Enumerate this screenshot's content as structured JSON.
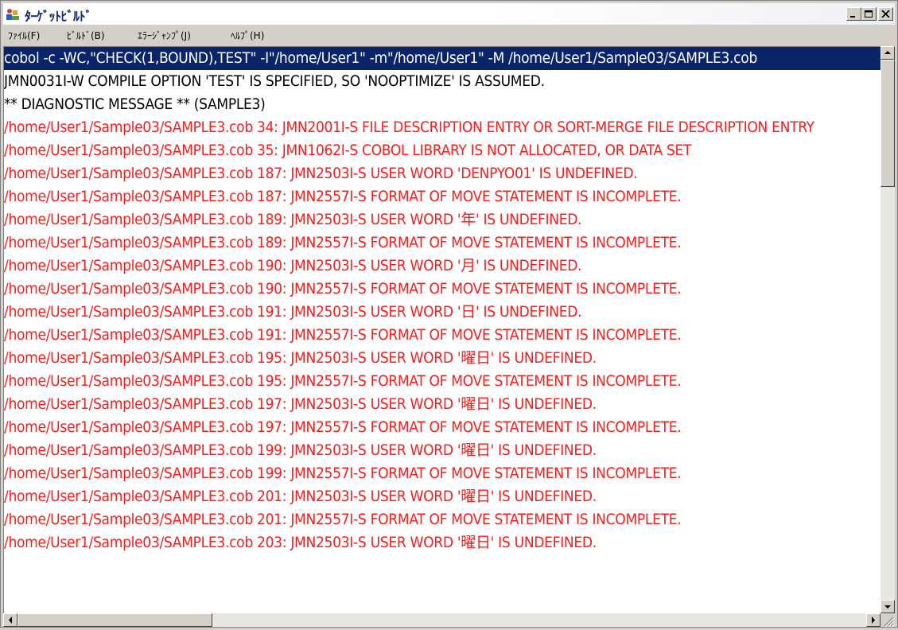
{
  "window": {
    "title": "ﾀｰｹﾞｯﾄﾋﾞﾙﾄﾞ",
    "icon": "build-app-icon",
    "caption_buttons": [
      "minimize-icon",
      "maximize-icon",
      "close-icon"
    ]
  },
  "menu": {
    "items": [
      "ﾌｧｲﾙ(F)",
      "ﾋﾞﾙﾄﾞ(B)",
      "ｴﾗｰｼﾞｬﾝﾌﾟ(J)",
      "ﾍﾙﾌﾟ(H)"
    ]
  },
  "output": {
    "lines": [
      "cobol -c -WC,\"CHECK(1,BOUND),TEST\" -I\"/home/User1\" -m\"/home/User1\" -M /home/User1/Sample03/SAMPLE3.cob",
      "JMN0031I-W  COMPILE OPTION 'TEST' IS SPECIFIED, SO 'NOOPTIMIZE' IS ASSUMED.",
      "** DIAGNOSTIC MESSAGE ** (SAMPLE3)",
      "/home/User1/Sample03/SAMPLE3.cob 34: JMN2001I-S  FILE DESCRIPTION ENTRY OR SORT-MERGE FILE DESCRIPTION ENTRY",
      "/home/User1/Sample03/SAMPLE3.cob 35: JMN1062I-S  COBOL LIBRARY IS NOT ALLOCATED, OR DATA SET",
      "/home/User1/Sample03/SAMPLE3.cob 187: JMN2503I-S  USER WORD 'DENPYO01' IS UNDEFINED.",
      "/home/User1/Sample03/SAMPLE3.cob 187: JMN2557I-S  FORMAT OF MOVE STATEMENT IS INCOMPLETE.",
      "/home/User1/Sample03/SAMPLE3.cob 189: JMN2503I-S  USER WORD '年' IS UNDEFINED.",
      "/home/User1/Sample03/SAMPLE3.cob 189: JMN2557I-S  FORMAT OF MOVE STATEMENT IS INCOMPLETE.",
      "/home/User1/Sample03/SAMPLE3.cob 190: JMN2503I-S  USER WORD '月' IS UNDEFINED.",
      "/home/User1/Sample03/SAMPLE3.cob 190: JMN2557I-S  FORMAT OF MOVE STATEMENT IS INCOMPLETE.",
      "/home/User1/Sample03/SAMPLE3.cob 191: JMN2503I-S  USER WORD '日' IS UNDEFINED.",
      "/home/User1/Sample03/SAMPLE3.cob 191: JMN2557I-S  FORMAT OF MOVE STATEMENT IS INCOMPLETE.",
      "/home/User1/Sample03/SAMPLE3.cob 195: JMN2503I-S  USER WORD '曜日' IS UNDEFINED.",
      "/home/User1/Sample03/SAMPLE3.cob 195: JMN2557I-S  FORMAT OF MOVE STATEMENT IS INCOMPLETE.",
      "/home/User1/Sample03/SAMPLE3.cob 197: JMN2503I-S  USER WORD '曜日' IS UNDEFINED.",
      "/home/User1/Sample03/SAMPLE3.cob 197: JMN2557I-S  FORMAT OF MOVE STATEMENT IS INCOMPLETE.",
      "/home/User1/Sample03/SAMPLE3.cob 199: JMN2503I-S  USER WORD '曜日' IS UNDEFINED.",
      "/home/User1/Sample03/SAMPLE3.cob 199: JMN2557I-S  FORMAT OF MOVE STATEMENT IS INCOMPLETE.",
      "/home/User1/Sample03/SAMPLE3.cob 201: JMN2503I-S  USER WORD '曜日' IS UNDEFINED.",
      "/home/User1/Sample03/SAMPLE3.cob 201: JMN2557I-S  FORMAT OF MOVE STATEMENT IS INCOMPLETE.",
      "/home/User1/Sample03/SAMPLE3.cob 203: JMN2503I-S  USER WORD '曜日' IS UNDEFINED."
    ]
  },
  "colors": {
    "selection_bg": "#0a246a",
    "info_text": "#000000",
    "error_text": "#ff1a1a",
    "title_text": "#0f2a6a"
  },
  "scrollbars": {
    "vertical": [
      "scroll-up-arrow-icon",
      "scroll-down-arrow-icon"
    ],
    "horizontal": [
      "scroll-left-arrow-icon",
      "scroll-right-arrow-icon"
    ]
  }
}
